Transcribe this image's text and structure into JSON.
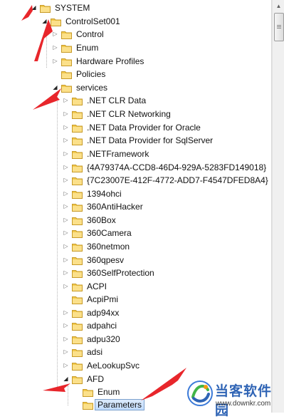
{
  "tree": {
    "nodes": [
      {
        "label": "SYSTEM",
        "expanded": true
      },
      {
        "label": "ControlSet001",
        "expanded": true
      },
      {
        "label": "Control",
        "expanded": false
      },
      {
        "label": "Enum",
        "expanded": false
      },
      {
        "label": "Hardware Profiles",
        "expanded": false
      },
      {
        "label": "Policies",
        "expanded": false
      },
      {
        "label": "services",
        "expanded": true
      },
      {
        "label": ".NET CLR Data",
        "expanded": false
      },
      {
        "label": ".NET CLR Networking",
        "expanded": false
      },
      {
        "label": ".NET Data Provider for Oracle",
        "expanded": false
      },
      {
        "label": ".NET Data Provider for SqlServer",
        "expanded": false
      },
      {
        "label": ".NETFramework",
        "expanded": false
      },
      {
        "label": "{4A79374A-CCD8-46D4-929A-5283FD149018}",
        "expanded": false
      },
      {
        "label": "{7C23007E-412F-4772-ADD7-F4547DFED8A4}",
        "expanded": false
      },
      {
        "label": "1394ohci",
        "expanded": false
      },
      {
        "label": "360AntiHacker",
        "expanded": false
      },
      {
        "label": "360Box",
        "expanded": false
      },
      {
        "label": "360Camera",
        "expanded": false
      },
      {
        "label": "360netmon",
        "expanded": false
      },
      {
        "label": "360qpesv",
        "expanded": false
      },
      {
        "label": "360SelfProtection",
        "expanded": false
      },
      {
        "label": "ACPI",
        "expanded": false
      },
      {
        "label": "AcpiPmi",
        "expanded": false
      },
      {
        "label": "adp94xx",
        "expanded": false
      },
      {
        "label": "adpahci",
        "expanded": false
      },
      {
        "label": "adpu320",
        "expanded": false
      },
      {
        "label": "adsi",
        "expanded": false
      },
      {
        "label": "AeLookupSvc",
        "expanded": false
      },
      {
        "label": "AFD",
        "expanded": true
      },
      {
        "label": "Enum",
        "expanded": false
      },
      {
        "label": "Parameters",
        "expanded": false,
        "selected": true
      }
    ]
  },
  "watermark": {
    "title": "当客软件园",
    "url": "www.downkr.com"
  },
  "colors": {
    "folder_fill": "#f2c94c",
    "selection_border": "#7da2ce",
    "annotation_arrow": "#e8262b",
    "watermark_blue": "#2f64b5"
  }
}
